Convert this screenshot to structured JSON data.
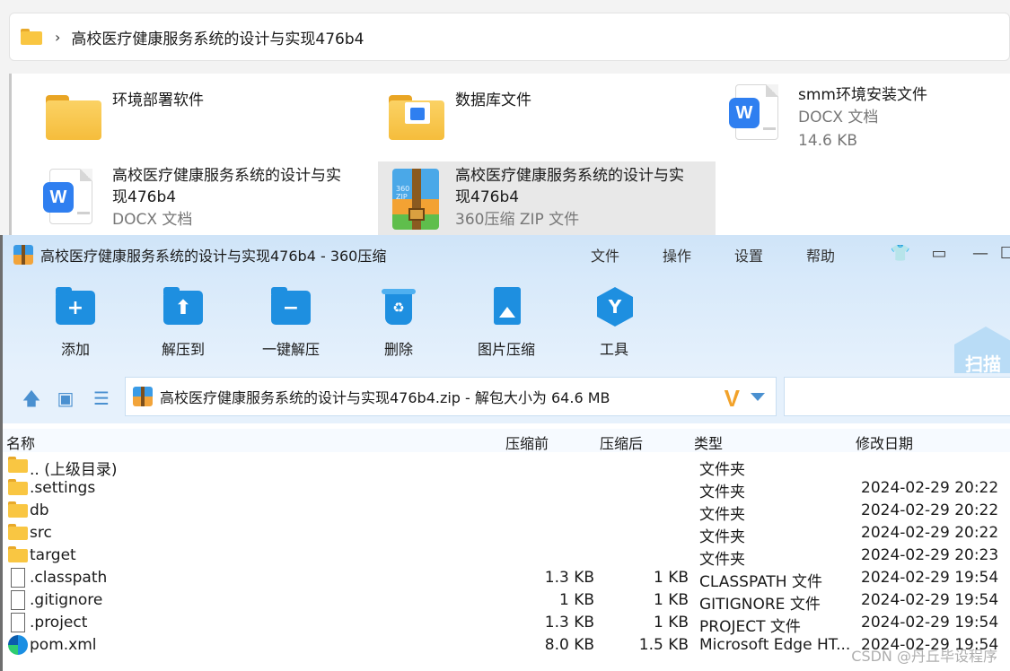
{
  "explorer": {
    "breadcrumb": "高校医疗健康服务系统的设计与实现476b4",
    "tiles": [
      {
        "name": "环境部署软件",
        "sub": "",
        "sub2": ""
      },
      {
        "name": "数据库文件",
        "sub": "",
        "sub2": ""
      },
      {
        "name": "smm环境安装文件",
        "sub": "DOCX 文档",
        "sub2": "14.6 KB"
      },
      {
        "name_l1": "高校医疗健康服务系统的设计与实",
        "name_l2": "现476b4",
        "sub": "DOCX 文档"
      },
      {
        "name_l1": "高校医疗健康服务系统的设计与实",
        "name_l2": "现476b4",
        "sub": "360压缩 ZIP 文件",
        "zip_label": "360\nZIP"
      }
    ]
  },
  "app": {
    "title": "高校医疗健康服务系统的设计与实现476b4 - 360压缩",
    "menu": [
      "文件",
      "操作",
      "设置",
      "帮助"
    ],
    "tools": [
      "添加",
      "解压到",
      "一键解压",
      "删除",
      "图片压缩",
      "工具"
    ],
    "scan_label": "扫描",
    "path_text": "高校医疗健康服务系统的设计与实现476b4.zip - 解包大小为 64.6 MB",
    "logo_letter": "V",
    "window_controls": [
      "—",
      "☐"
    ]
  },
  "table": {
    "headers": [
      "名称",
      "压缩前",
      "压缩后",
      "类型",
      "修改日期"
    ],
    "rows": [
      {
        "icon": "folder",
        "name": ".. (上级目录)",
        "size": "",
        "comp": "",
        "type": "文件夹",
        "date": ""
      },
      {
        "icon": "folder",
        "name": ".settings",
        "size": "",
        "comp": "",
        "type": "文件夹",
        "date": "2024-02-29 20:22"
      },
      {
        "icon": "folder",
        "name": "db",
        "size": "",
        "comp": "",
        "type": "文件夹",
        "date": "2024-02-29 20:22"
      },
      {
        "icon": "folder",
        "name": "src",
        "size": "",
        "comp": "",
        "type": "文件夹",
        "date": "2024-02-29 20:22"
      },
      {
        "icon": "folder",
        "name": "target",
        "size": "",
        "comp": "",
        "type": "文件夹",
        "date": "2024-02-29 20:23"
      },
      {
        "icon": "file",
        "name": ".classpath",
        "size": "1.3 KB",
        "comp": "1 KB",
        "type": "CLASSPATH 文件",
        "date": "2024-02-29 19:54"
      },
      {
        "icon": "file",
        "name": ".gitignore",
        "size": "1 KB",
        "comp": "1 KB",
        "type": "GITIGNORE 文件",
        "date": "2024-02-29 19:54"
      },
      {
        "icon": "file",
        "name": ".project",
        "size": "1.3 KB",
        "comp": "1 KB",
        "type": "PROJECT 文件",
        "date": "2024-02-29 19:54"
      },
      {
        "icon": "edge",
        "name": "pom.xml",
        "size": "8.0 KB",
        "comp": "1.5 KB",
        "type": "Microsoft Edge HT...",
        "date": "2024-02-29 19:54"
      }
    ]
  },
  "watermark": "CSDN @丹丘毕设程序"
}
